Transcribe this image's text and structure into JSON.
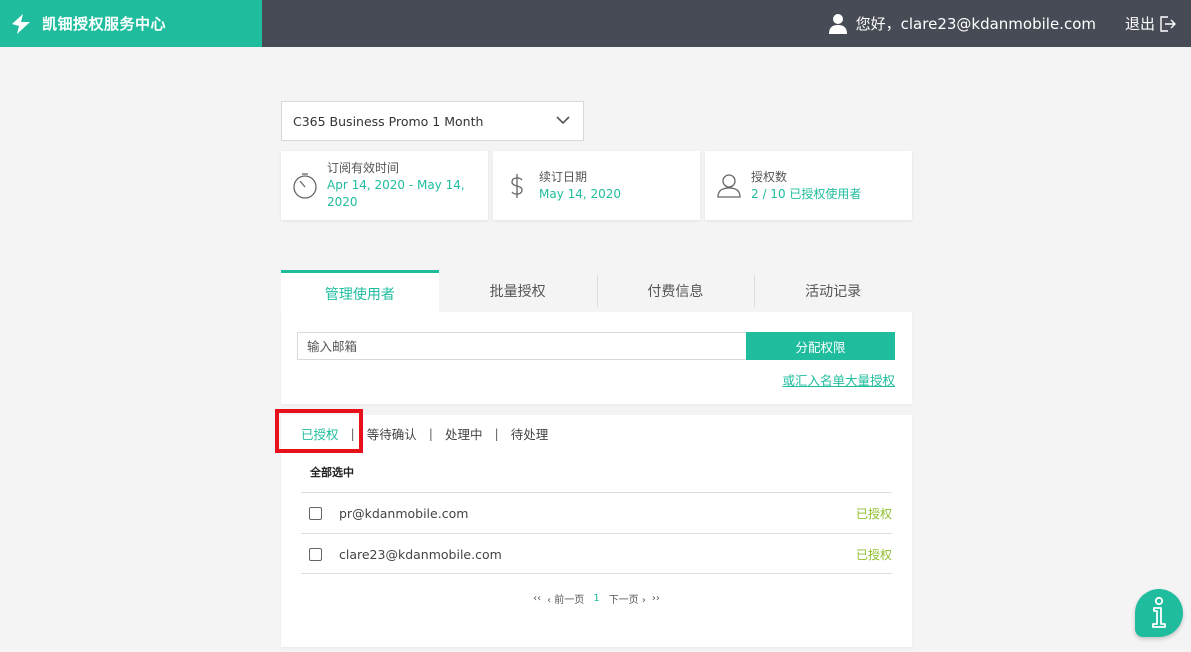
{
  "header": {
    "brand_name": "凯钿授权服务中心",
    "greeting": "您好，clare23@kdanmobile.com",
    "logout_label": "退出"
  },
  "product_select": {
    "selected": "C365 Business Promo 1 Month"
  },
  "cards": [
    {
      "title": "订阅有效时间",
      "value": "Apr 14, 2020 - May 14, 2020",
      "icon": "timer-icon"
    },
    {
      "title": "续订日期",
      "value": "May 14, 2020",
      "icon": "dollar-icon"
    },
    {
      "title": "授权数",
      "value": "2 / 10 已授权使用者",
      "icon": "user-icon"
    }
  ],
  "tabs": [
    {
      "label": "管理使用者",
      "active": true
    },
    {
      "label": "批量授权",
      "active": false
    },
    {
      "label": "付费信息",
      "active": false
    },
    {
      "label": "活动记录",
      "active": false
    }
  ],
  "assign": {
    "email_placeholder": "输入邮箱",
    "button_label": "分配权限",
    "bulk_link": "或汇入名单大量授权"
  },
  "filters": [
    {
      "label": "已授权",
      "active": true
    },
    {
      "label": "等待确认",
      "active": false
    },
    {
      "label": "处理中",
      "active": false
    },
    {
      "label": "待处理",
      "active": false
    }
  ],
  "list": {
    "select_all_label": "全部选中",
    "rows": [
      {
        "email": "pr@kdanmobile.com",
        "status": "已授权"
      },
      {
        "email": "clare23@kdanmobile.com",
        "status": "已授权"
      }
    ]
  },
  "pager": {
    "first": "‹‹",
    "prev": "‹ 前一页",
    "current": "1",
    "next": "下一页 ›",
    "last": "››"
  },
  "colors": {
    "accent": "#1fbd9e",
    "header_bg": "#474b56",
    "status_green": "#8dbf2c",
    "highlight_red": "#e8101a"
  }
}
